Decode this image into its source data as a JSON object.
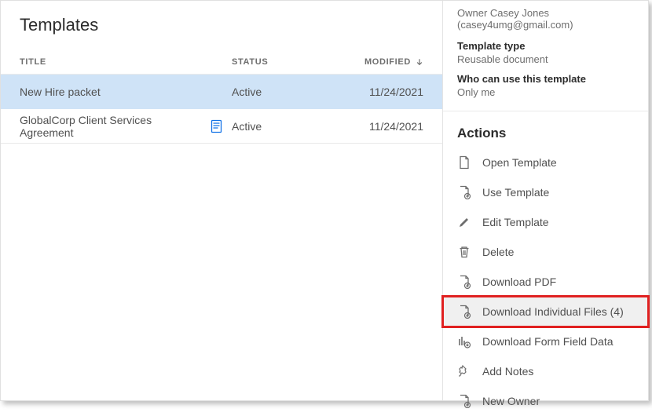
{
  "page_title": "Templates",
  "columns": {
    "title": "TITLE",
    "status": "STATUS",
    "modified": "MODIFIED"
  },
  "rows": [
    {
      "title": "New Hire packet",
      "status": "Active",
      "modified": "11/24/2021",
      "selected": true,
      "has_icon": false
    },
    {
      "title": "GlobalCorp Client Services Agreement",
      "status": "Active",
      "modified": "11/24/2021",
      "selected": false,
      "has_icon": true
    }
  ],
  "details": {
    "owner_line": "Owner Casey Jones (casey4umg@gmail.com)",
    "template_type_label": "Template type",
    "template_type_value": "Reusable document",
    "who_label": "Who can use this template",
    "who_value": "Only me"
  },
  "actions_header": "Actions",
  "actions": [
    {
      "id": "open-template",
      "label": "Open Template",
      "icon": "page"
    },
    {
      "id": "use-template",
      "label": "Use Template",
      "icon": "page-plus"
    },
    {
      "id": "edit-template",
      "label": "Edit Template",
      "icon": "pencil"
    },
    {
      "id": "delete",
      "label": "Delete",
      "icon": "trash"
    },
    {
      "id": "download-pdf",
      "label": "Download PDF",
      "icon": "page-down"
    },
    {
      "id": "download-individual-files",
      "label": "Download Individual Files (4)",
      "icon": "page-down",
      "highlight": true
    },
    {
      "id": "download-form-field-data",
      "label": "Download Form Field Data",
      "icon": "chart-down"
    },
    {
      "id": "add-notes",
      "label": "Add Notes",
      "icon": "pin"
    },
    {
      "id": "new-owner",
      "label": "New Owner",
      "icon": "page-plus"
    }
  ]
}
